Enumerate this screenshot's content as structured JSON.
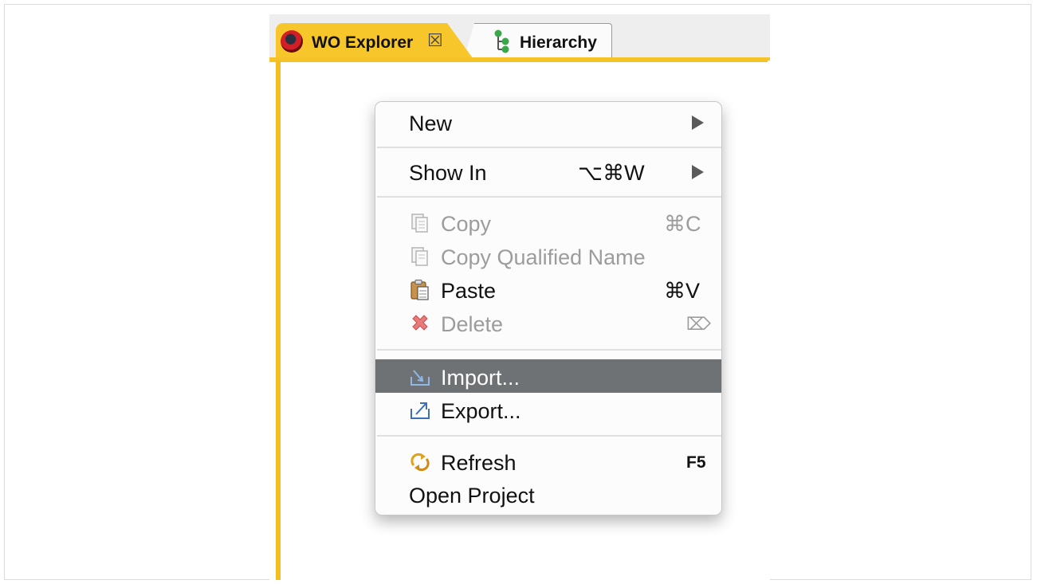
{
  "tabs": [
    {
      "label": "WO Explorer",
      "icon": "wo-explorer-icon",
      "active": true
    },
    {
      "label": "Hierarchy",
      "icon": "hierarchy-icon",
      "active": false
    }
  ],
  "tab_close_glyph": "☒",
  "colors": {
    "active_tab": "#f6c62a",
    "menu_highlight": "#6f7274",
    "disabled_text": "#9c9c9c"
  },
  "context_menu": {
    "items": [
      {
        "label": "New",
        "submenu": true
      },
      {
        "label": "Show In",
        "shortcut": "⌥⌘W",
        "submenu": true
      },
      {
        "label": "Copy",
        "shortcut": "⌘C",
        "icon": "copy-icon",
        "disabled": true
      },
      {
        "label": "Copy Qualified Name",
        "icon": "copy-qualified-name-icon",
        "disabled": true
      },
      {
        "label": "Paste",
        "shortcut": "⌘V",
        "icon": "paste-icon"
      },
      {
        "label": "Delete",
        "shortcut": "⌦",
        "icon": "delete-icon",
        "disabled": true
      },
      {
        "label": "Import...",
        "icon": "import-icon",
        "selected": true
      },
      {
        "label": "Export...",
        "icon": "export-icon"
      },
      {
        "label": "Refresh",
        "shortcut": "F5",
        "icon": "refresh-icon"
      },
      {
        "label": "Open Project"
      }
    ]
  }
}
